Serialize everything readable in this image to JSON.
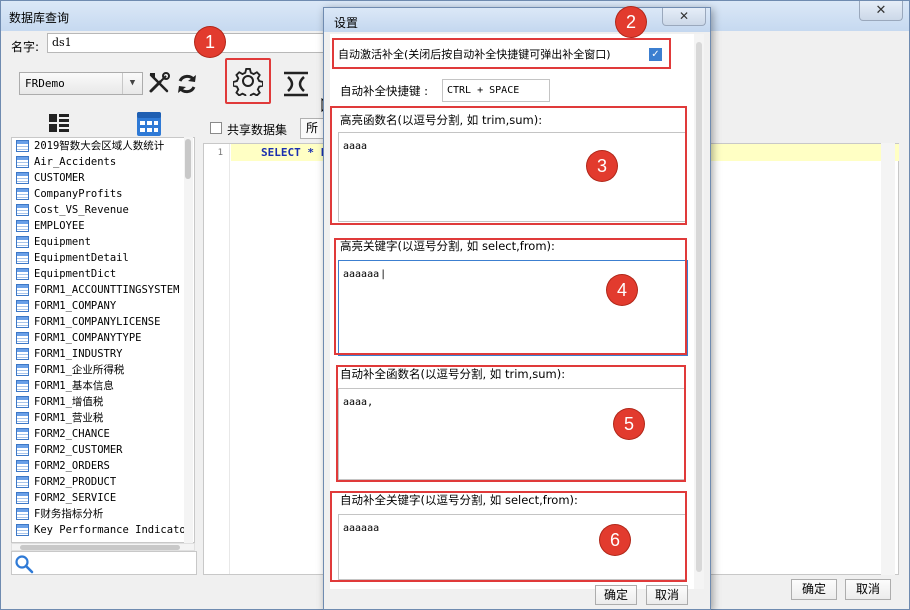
{
  "main": {
    "title": "数据库查询",
    "close_glyph": "✕",
    "name_label": "名字:",
    "name_value": "ds1",
    "datasource": "FRDemo",
    "share_label": "共享数据集",
    "all_label": "所有",
    "line_number": "1",
    "sql_text": "SELECT * FROM",
    "ok_label": "确定",
    "cancel_label": "取消"
  },
  "tables": [
    "2019智数大会区域人数统计",
    "Air_Accidents",
    "CUSTOMER",
    "CompanyProfits",
    "Cost_VS_Revenue",
    "EMPLOYEE",
    "Equipment",
    "EquipmentDetail",
    "EquipmentDict",
    "FORM1_ACCOUNTTINGSYSTEM",
    "FORM1_COMPANY",
    "FORM1_COMPANYLICENSE",
    "FORM1_COMPANYTYPE",
    "FORM1_INDUSTRY",
    "FORM1_企业所得税",
    "FORM1_基本信息",
    "FORM1_增值税",
    "FORM1_营业税",
    "FORM2_CHANCE",
    "FORM2_CUSTOMER",
    "FORM2_ORDERS",
    "FORM2_PRODUCT",
    "FORM2_SERVICE",
    "F财务指标分析",
    "Key Performance Indicator"
  ],
  "dialog": {
    "title": "设置",
    "close_glyph": "✕",
    "auto_activate_label": "自动激活补全(关闭后按自动补全快捷键可弹出补全窗口)",
    "auto_activate_checked": true,
    "shortcut_label": "自动补全快捷键 :",
    "shortcut_value": "CTRL + SPACE",
    "highlight_functions_label": "高亮函数名(以逗号分割, 如 trim,sum):",
    "highlight_functions_value": "aaaa",
    "highlight_keywords_label": "高亮关键字(以逗号分割, 如 select,from):",
    "highlight_keywords_value": "aaaaaa",
    "autocomplete_functions_label": "自动补全函数名(以逗号分割, 如 trim,sum):",
    "autocomplete_functions_value": "aaaa,",
    "autocomplete_keywords_label": "自动补全关键字(以逗号分割, 如 select,from):",
    "autocomplete_keywords_value": "aaaaaa",
    "ok_label": "确定",
    "cancel_label": "取消"
  },
  "callouts": [
    "1",
    "2",
    "3",
    "4",
    "5",
    "6"
  ],
  "colors": {
    "callout": "#e23b2e",
    "highlight_border": "#e03a3a",
    "sql_keyword": "#1a2fb0",
    "current_line": "#ffffc4",
    "table_icon": "#3d78c7"
  },
  "icons": [
    "tools-icon",
    "refresh-icon",
    "gear-icon",
    "split-icon",
    "list-view-icon",
    "grid-view-icon",
    "table-icon",
    "search-icon",
    "checkbox-checked-icon"
  ]
}
